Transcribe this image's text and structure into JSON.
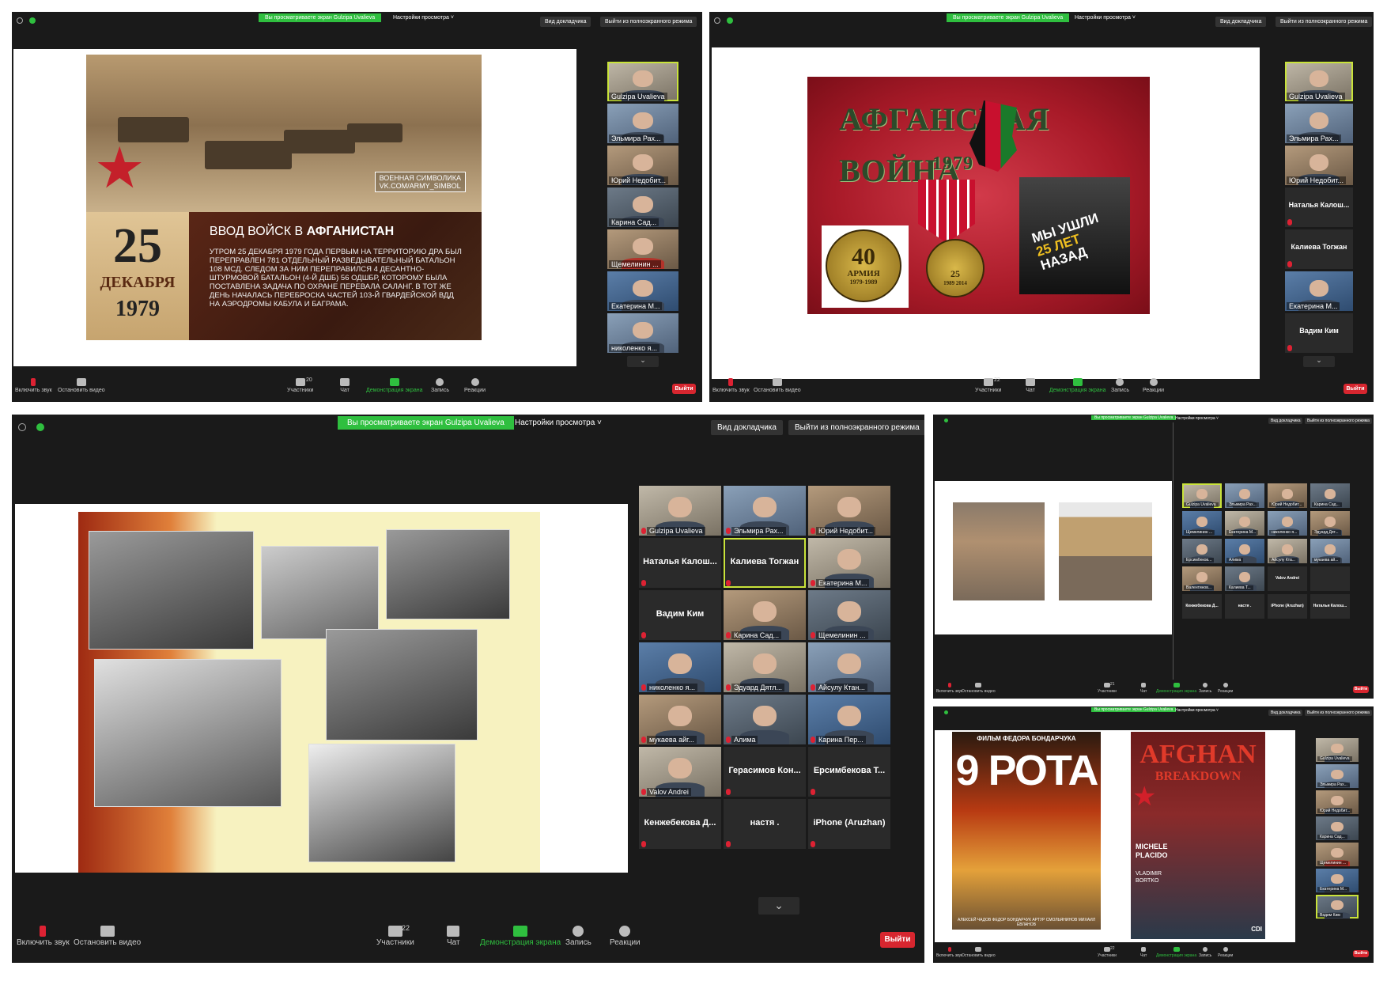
{
  "windows": [
    {
      "id": "top-left",
      "sharing_banner": "Вы просматриваете экран Gulzipa Uvalieva",
      "view_options": "Настройки просмотра ˅",
      "speaker_view": "Вид докладчика",
      "exit_fullscreen": "Выйти из полноэкранного режима",
      "slide": {
        "watermark_line1": "ВОЕННАЯ СИМВОЛИКА",
        "watermark_line2": "VK.COM/ARMY_SIMBOL",
        "day": "25",
        "month": "ДЕКАБРЯ",
        "year": "1979",
        "heading_plain": "ВВОД ВОЙСК В ",
        "heading_bold": "АФГАНИСТАН",
        "body": "Утром 25 декабря 1979 года первым на территорию ДРА был переправлен 781 отдельный разведывательный батальон 108 МСД. Следом за ним переправился 4 десантно-штурмовой батальон (4-й ДШБ) 56 ОДШБр, которому была поставлена задача по охране перевала Саланг. В тот же день началась переброска частей 103-й гвардейской ВДД на аэродромы Кабула и Баграма."
      },
      "participants": [
        "Gulzipa Uvalieva",
        "Эльмира Рах...",
        "Юрий Недобит...",
        "Карина Сад...",
        "Щемелинин ...",
        "Екатерина М...",
        "николенко я..."
      ],
      "toolbar": {
        "unmute": "Включить звук",
        "video": "Остановить видео",
        "participants_count": "20",
        "participants": "Участники",
        "chat": "Чат",
        "share": "Демонстрация экрана",
        "record": "Запись",
        "reactions": "Реакции",
        "leave": "Выйти"
      }
    },
    {
      "id": "top-right",
      "sharing_banner": "Вы просматриваете экран Gulzipa Uvalieva",
      "view_options": "Настройки просмотра ˅",
      "speaker_view": "Вид докладчика",
      "exit_fullscreen": "Выйти из полноэкранного режима",
      "slide": {
        "title_line1": "АФГАНСКАЯ",
        "title_line2": "ВОЙНА",
        "title_year": "1979",
        "medal_number": "40",
        "medal_text": "АРМИЯ",
        "medal_years": "1979-1989",
        "medal2_years": "1989 2014",
        "medal2_num": "25",
        "poster_line1": "МЫ УШЛИ",
        "poster_line2": "25 ЛЕТ",
        "poster_line3": "НАЗАД"
      },
      "participants": [
        "Gulzipa Uvalieva",
        "Эльмира Рах...",
        "Юрий Недобит...",
        "Наталья Калош...",
        "Калиева Тогжан",
        "Екатерина М...",
        "Вадим Ким"
      ],
      "toolbar": {
        "unmute": "Включить звук",
        "video": "Остановить видео",
        "participants_count": "22",
        "participants": "Участники",
        "chat": "Чат",
        "share": "Демонстрация экрана",
        "record": "Запись",
        "reactions": "Реакции",
        "leave": "Выйти"
      }
    },
    {
      "id": "bottom-left",
      "sharing_banner": "Вы просматриваете экран Gulzipa Uvalieva",
      "view_options": "Настройки просмотра ˅",
      "speaker_view": "Вид докладчика",
      "exit_fullscreen": "Выйти из полноэкранного режима",
      "grid": [
        {
          "name": "Gulzipa Uvalieva",
          "type": "video"
        },
        {
          "name": "Эльмира Рах...",
          "type": "video"
        },
        {
          "name": "Юрий Недобит...",
          "type": "video"
        },
        {
          "name": "Наталья  Калош...",
          "type": "name"
        },
        {
          "name": "Калиева Тогжан",
          "type": "name"
        },
        {
          "name": "Екатерина М...",
          "type": "video"
        },
        {
          "name": "Вадим Ким",
          "type": "name"
        },
        {
          "name": "Карина Сад...",
          "type": "video"
        },
        {
          "name": "Щемелинин ...",
          "type": "video"
        },
        {
          "name": "николенко я...",
          "type": "video"
        },
        {
          "name": "Эдуард Дятл...",
          "type": "video"
        },
        {
          "name": "Айсулу Ктан...",
          "type": "video"
        },
        {
          "name": "мукаева айг...",
          "type": "video"
        },
        {
          "name": "Алима",
          "type": "video"
        },
        {
          "name": "Карина Пер...",
          "type": "video"
        },
        {
          "name": "Valov Andrei",
          "type": "video"
        },
        {
          "name": "Герасимов Кон...",
          "type": "name"
        },
        {
          "name": "Ерсимбекова Т...",
          "type": "name"
        },
        {
          "name": "Кенжебекова Д...",
          "type": "name"
        },
        {
          "name": "настя .",
          "type": "name"
        },
        {
          "name": "iPhone (Aruzhan)",
          "type": "name"
        }
      ],
      "toolbar": {
        "unmute": "Включить звук",
        "video": "Остановить видео",
        "participants_count": "22",
        "participants": "Участники",
        "chat": "Чат",
        "share": "Демонстрация экрана",
        "record": "Запись",
        "reactions": "Реакции",
        "leave": "Выйти"
      }
    },
    {
      "id": "mid-right",
      "sharing_banner": "Вы просматриваете экран Gulzipa Uvalieva",
      "view_options": "Настройки просмотра ˅",
      "speaker_view": "Вид докладчика",
      "exit_fullscreen": "Выйти из полноэкранного режима",
      "grid": [
        "Gulzipa Uvalieva",
        "Эльмира Рах...",
        "Юрий Недобит...",
        "Карина Сад...",
        "Щемелинин ...",
        "Екатерина М...",
        "николенко я...",
        "Эдуард Дят...",
        "Ерсимбеков...",
        "Алима",
        "Айсулу Кта...",
        "мукаева ай...",
        "Валентинов...",
        "Калиева Т...",
        "Valov Andrei",
        "",
        "Кенжебекова Д...",
        "настя .",
        "iPhone (Aruzhan)",
        "Наталья Калош..."
      ],
      "toolbar": {
        "unmute": "Включить звук",
        "video": "Остановить видео",
        "participants_count": "21",
        "participants": "Участники",
        "chat": "Чат",
        "share": "Демонстрация экрана",
        "record": "Запись",
        "reactions": "Реакции",
        "leave": "Выйти"
      }
    },
    {
      "id": "bottom-right",
      "sharing_banner": "Вы просматриваете экран Gulzipa Uvalieva",
      "view_options": "Настройки просмотра ˅",
      "speaker_view": "Вид докладчика",
      "exit_fullscreen": "Выйти из полноэкранного режима",
      "poster1": {
        "top": "ФИЛЬМ ФЕДОРА БОНДАРЧУКА",
        "title": "9 РОТА",
        "cast": "АЛЕКСЕЙ ЧАДОВ  ФЕДОР БОНДАРЧУК  АРТУР СМОЛЬЯНИНОВ  МИХАИЛ ЕВЛАНОВ"
      },
      "poster2": {
        "title1": "AFGHAN",
        "title2": "BREAKDOWN",
        "actor1": "MICHELE",
        "actor2": "PLACIDO",
        "director1": "VLADIMIR",
        "director2": "BORTKO",
        "badge": "CDI"
      },
      "participants": [
        "Gulzipa Uvalieva",
        "Эльмира Рах...",
        "Юрий Недобит...",
        "Карина Сад...",
        "Щемелинин ...",
        "Екатерина М...",
        "Вадим Ким"
      ],
      "toolbar": {
        "unmute": "Включить звук",
        "video": "Остановить видео",
        "participants_count": "22",
        "participants": "Участники",
        "chat": "Чат",
        "share": "Демонстрация экрана",
        "record": "Запись",
        "reactions": "Реакции",
        "leave": "Выйти"
      }
    }
  ],
  "colors": {
    "zoom_bg": "#1a1a1a",
    "share_green": "#2fbf3f",
    "leave_red": "#d7262f",
    "active_outline": "#c9e33a"
  }
}
